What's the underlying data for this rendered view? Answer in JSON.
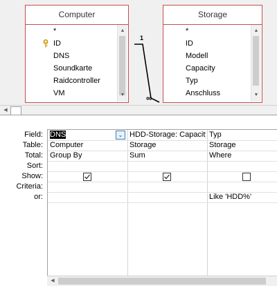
{
  "tables": [
    {
      "title": "Computer",
      "fields": [
        "*",
        "ID",
        "DNS",
        "Soundkarte",
        "Raidcontroller",
        "VM"
      ],
      "key_field_index": 1
    },
    {
      "title": "Storage",
      "fields": [
        "*",
        "ID",
        "Modell",
        "Capacity",
        "Typ",
        "Anschluss"
      ],
      "key_field_index": 1
    }
  ],
  "relationship": {
    "one_label": "1",
    "many_label": "∞"
  },
  "row_labels": {
    "field": "Field:",
    "table": "Table:",
    "total": "Total:",
    "sort": "Sort:",
    "show": "Show:",
    "criteria": "Criteria:",
    "or": "or:"
  },
  "columns": [
    {
      "field": "DNS",
      "table": "Computer",
      "total": "Group By",
      "sort": "",
      "show": true,
      "criteria": "",
      "or": ""
    },
    {
      "field": "HDD-Storage: Capacity",
      "table": "Storage",
      "total": "Sum",
      "sort": "",
      "show": true,
      "criteria": "",
      "or": ""
    },
    {
      "field": "Typ",
      "table": "Storage",
      "total": "Where",
      "sort": "",
      "show": false,
      "criteria": "Like 'HDD%'",
      "or": ""
    }
  ],
  "icons": {
    "key": "key-icon",
    "dropdown": "chevron-down-icon",
    "checkmark": "checkmark-icon"
  },
  "colors": {
    "table_border": "#c0504d",
    "dropdown_border": "#3c7fb1"
  }
}
